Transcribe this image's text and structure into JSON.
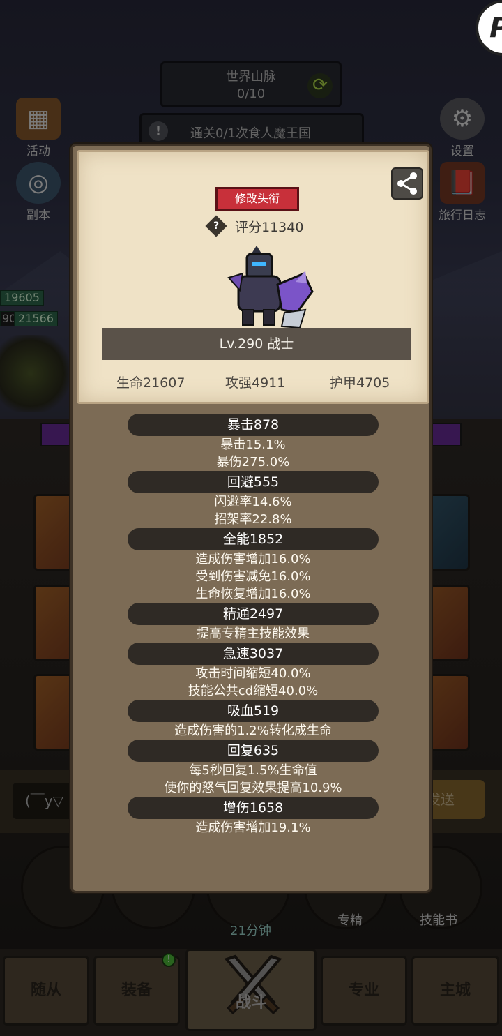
{
  "background": {
    "top_bar": {
      "title": "世界山脉",
      "progress": "0/10"
    },
    "quest": {
      "text": "通关0/1次食人魔王国"
    },
    "left_buttons": [
      {
        "label": "活动"
      },
      {
        "label": "副本"
      }
    ],
    "right_buttons": [
      {
        "label": "设置"
      },
      {
        "label": "旅行日志"
      }
    ],
    "hp_tags": [
      "19605",
      "21566"
    ],
    "hp_tag_prefix": "90",
    "chat": {
      "input_text": "(￣y▽",
      "send_label": "发送"
    },
    "skills": {
      "specialty_label": "专精",
      "skillbook_label": "技能书",
      "timer": "21分钟"
    },
    "bottom_nav": [
      {
        "label": "随从"
      },
      {
        "label": "装备"
      },
      {
        "label": "战斗"
      },
      {
        "label": "专业"
      },
      {
        "label": "主城"
      }
    ],
    "corner_logo": "P"
  },
  "panel": {
    "change_title_label": "修改头衔",
    "score": "评分11340",
    "level_class": "Lv.290 战士",
    "main_stats": {
      "hp": "生命21607",
      "attack": "攻强4911",
      "armor": "护甲4705"
    },
    "attributes": [
      {
        "header": "暴击878",
        "lines": [
          "暴击15.1%",
          "暴伤275.0%"
        ]
      },
      {
        "header": "回避555",
        "lines": [
          "闪避率14.6%",
          "招架率22.8%"
        ]
      },
      {
        "header": "全能1852",
        "lines": [
          "造成伤害增加16.0%",
          "受到伤害减免16.0%",
          "生命恢复增加16.0%"
        ]
      },
      {
        "header": "精通2497",
        "lines": [
          "提高专精主技能效果"
        ]
      },
      {
        "header": "急速3037",
        "lines": [
          "攻击时间缩短40.0%",
          "技能公共cd缩短40.0%"
        ]
      },
      {
        "header": "吸血519",
        "lines": [
          "造成伤害的1.2%转化成生命"
        ]
      },
      {
        "header": "回复635",
        "lines": [
          "每5秒回复1.5%生命值",
          "使你的怒气回复效果提高10.9%"
        ]
      },
      {
        "header": "增伤1658",
        "lines": [
          "造成伤害增加19.1%"
        ]
      }
    ]
  },
  "colors": {
    "panel_paper": "#efe2c6",
    "panel_body": "#7c6b55",
    "attr_header_bg": "#2f2a25",
    "title_button_red": "#c8303a"
  },
  "icons": {
    "share": "share-icon",
    "help": "question-icon",
    "refresh": "refresh-icon",
    "settings": "gear-icon"
  }
}
